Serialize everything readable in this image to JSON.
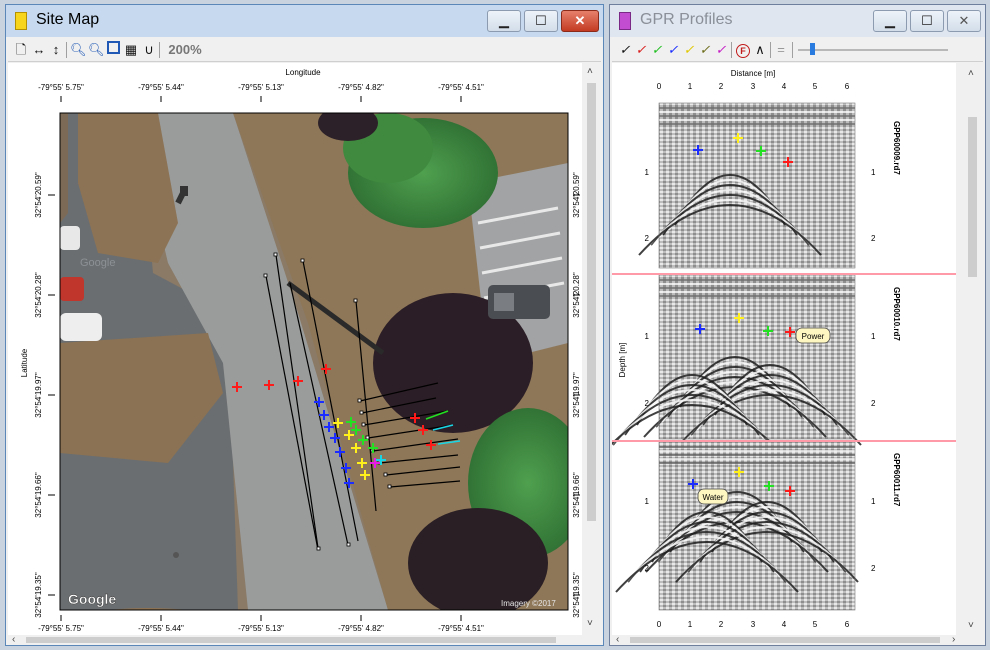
{
  "site_map": {
    "title": "Site Map",
    "zoom_label": "200%",
    "axis_top_title": "Longitude",
    "axis_left_title": "Latitude",
    "lon_ticks_top": [
      "-79°55' 5.75\"",
      "-79°55' 5.44\"",
      "-79°55' 5.13\"",
      "-79°55' 4.82\"",
      "-79°55' 4.51\""
    ],
    "lon_ticks_bottom": [
      "-79°55' 5.75\"",
      "-79°55' 5.44\"",
      "-79°55' 5.13\"",
      "-79°55' 4.82\"",
      "-79°55' 4.51\""
    ],
    "lat_ticks": [
      "32°54'20.59\"",
      "32°54'20.28\"",
      "32°54'19.97\"",
      "32°54'19.66\"",
      "32°54'19.35\""
    ],
    "map_brand": "Google",
    "map_brand_faint": "Google",
    "imagery_credit": "Imagery ©2017"
  },
  "gpr_profiles": {
    "title": "GPR Profiles",
    "axis_top_title": "Distance [m]",
    "axis_left_title": "Depth [m]",
    "distance_ticks": [
      "0",
      "1",
      "2",
      "3",
      "4",
      "5",
      "6"
    ],
    "profiles": [
      {
        "name": "GPP60009.rd7",
        "depth_ticks": [
          "1",
          "2"
        ],
        "left_ticks": [
          "1",
          "2"
        ],
        "annotation": ""
      },
      {
        "name": "GPP60010.rd7",
        "depth_ticks": [
          "1",
          "2"
        ],
        "left_ticks": [
          "1",
          "2"
        ],
        "annotation": "Power"
      },
      {
        "name": "GPP60011.rd7",
        "depth_ticks": [
          "1",
          "2"
        ],
        "left_ticks": [
          "1",
          "2"
        ],
        "annotation": "Water"
      }
    ]
  },
  "colors": {
    "marker_red": "#ff1a1a",
    "marker_blue": "#1a2cff",
    "marker_green": "#22e022",
    "marker_yellow": "#ffef1a",
    "marker_cyan": "#19d6e6",
    "marker_magenta": "#e61ae6",
    "separator_pink": "#ff9aa8"
  },
  "icons": {
    "site_map_toolbar": [
      "page-icon",
      "fit-width-icon",
      "fit-height-icon",
      "zoom-in-icon",
      "zoom-out-icon",
      "select-icon",
      "grid-icon",
      "magnet-icon"
    ],
    "gpr_toolbar": [
      "pick-black-icon",
      "pick-red-icon",
      "pick-green-icon",
      "pick-blue-icon",
      "pick-yellow-icon",
      "pick-olive-icon",
      "pick-magenta-icon",
      "filter-icon",
      "hyperbola-icon",
      "equal-icon",
      "gain-slider"
    ]
  }
}
